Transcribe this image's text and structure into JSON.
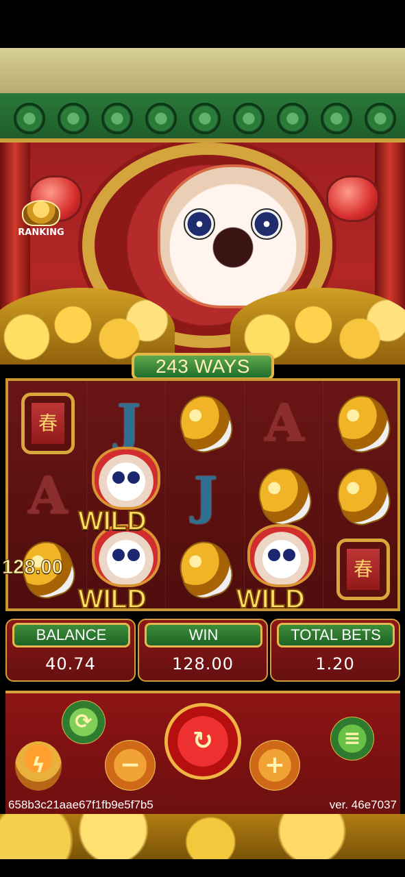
{
  "game": {
    "ranking_label": "RANKING",
    "ways_label": "243 WAYS",
    "payout_text": "128.00"
  },
  "reels": {
    "symbols": [
      [
        "bell",
        "letter-a",
        "fish"
      ],
      [
        "letter-j",
        "wild-lion",
        "wild-lion"
      ],
      [
        "fish",
        "letter-j",
        "fish"
      ],
      [
        "letter-a",
        "fish",
        "wild-lion"
      ],
      [
        "fish",
        "fish",
        "bell"
      ]
    ],
    "wild_label": "WILD",
    "letter_a": "A",
    "letter_j": "J"
  },
  "stats": {
    "balance_label": "BALANCE",
    "balance_value": "40.74",
    "win_label": "WIN",
    "win_value": "128.00",
    "total_bets_label": "TOTAL BETS",
    "total_bets_value": "1.20"
  },
  "footer": {
    "session_id": "658b3c21aae67f1fb9e5f7b5",
    "version": "ver. 46e7037"
  },
  "icons": {
    "ranking": "trophy-icon",
    "autoplay": "autoplay-icon",
    "fastplay": "lightning-icon",
    "minus": "minus-icon",
    "spin": "spin-icon",
    "plus": "plus-icon",
    "menu": "menu-icon"
  },
  "colors": {
    "gold": "#d7a03f",
    "red": "#8e1414",
    "green": "#2d7c2f",
    "cream": "#fff2b6"
  }
}
